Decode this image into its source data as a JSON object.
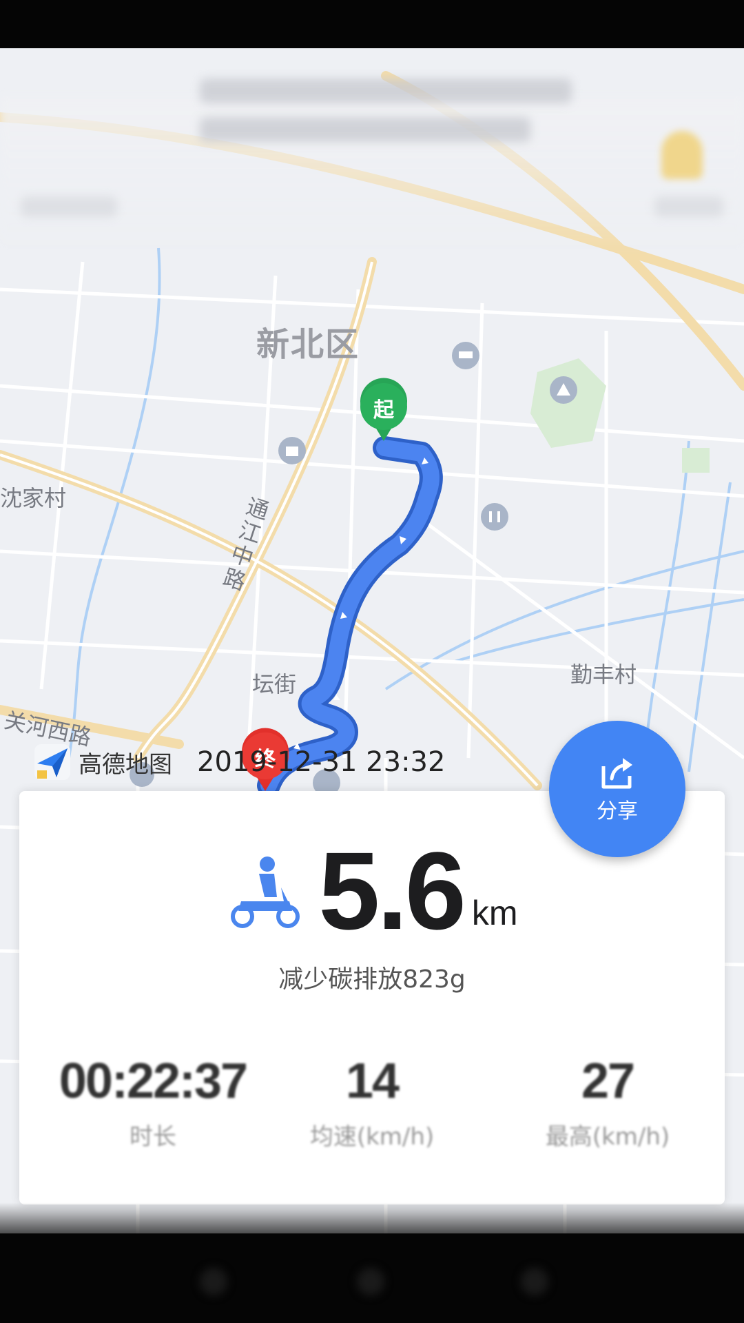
{
  "map": {
    "district_label": "新北区",
    "labels": {
      "village_left": "沈家村",
      "road_vertical": "通江中路",
      "street": "坛街",
      "road_guanhe": "关河西路",
      "village_right": "勤丰村"
    },
    "start_marker": "起",
    "end_marker": "终"
  },
  "watermark": {
    "brand": "高德地图",
    "timestamp": "2019-12-31 23:32"
  },
  "share": {
    "label": "分享"
  },
  "summary": {
    "distance": "5.6",
    "unit": "km",
    "carbon": "减少碳排放823g",
    "vehicle_icon": "electric-scooter-icon",
    "accent_color": "#4285f4"
  },
  "stats": [
    {
      "value": "00:22:37",
      "label": "时长"
    },
    {
      "value": "14",
      "label": "均速(km/h)"
    },
    {
      "value": "27",
      "label": "最高(km/h)"
    }
  ]
}
